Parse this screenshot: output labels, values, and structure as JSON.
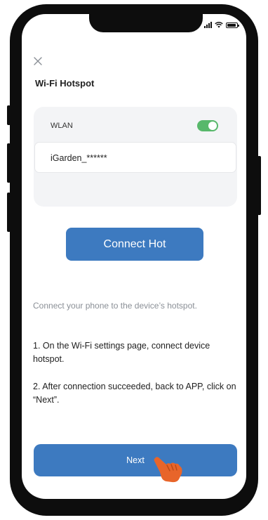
{
  "status_bar": {
    "icons": [
      "signal-icon",
      "wifi-icon",
      "battery-icon"
    ]
  },
  "header": {
    "close_icon": "close-icon",
    "title": "Wi-Fi Hotspot"
  },
  "wlan_card": {
    "label": "WLAN",
    "toggle_on": true,
    "network_name": "iGarden_******"
  },
  "connect_button": {
    "label": "Connect Hot"
  },
  "instructions": {
    "hint": "Connect your phone to the device’s hotspot.",
    "step_1": "1. On the Wi-Fi settings page, connect device hotspot.",
    "step_2": "2. After connection succeeded, back to APP, click on “Next”."
  },
  "next_button": {
    "label": "Next"
  },
  "colors": {
    "primary": "#3d7ac0",
    "toggle_on": "#58b86b",
    "card_bg": "#f3f4f6",
    "hand_pointer": "#e8652a"
  }
}
